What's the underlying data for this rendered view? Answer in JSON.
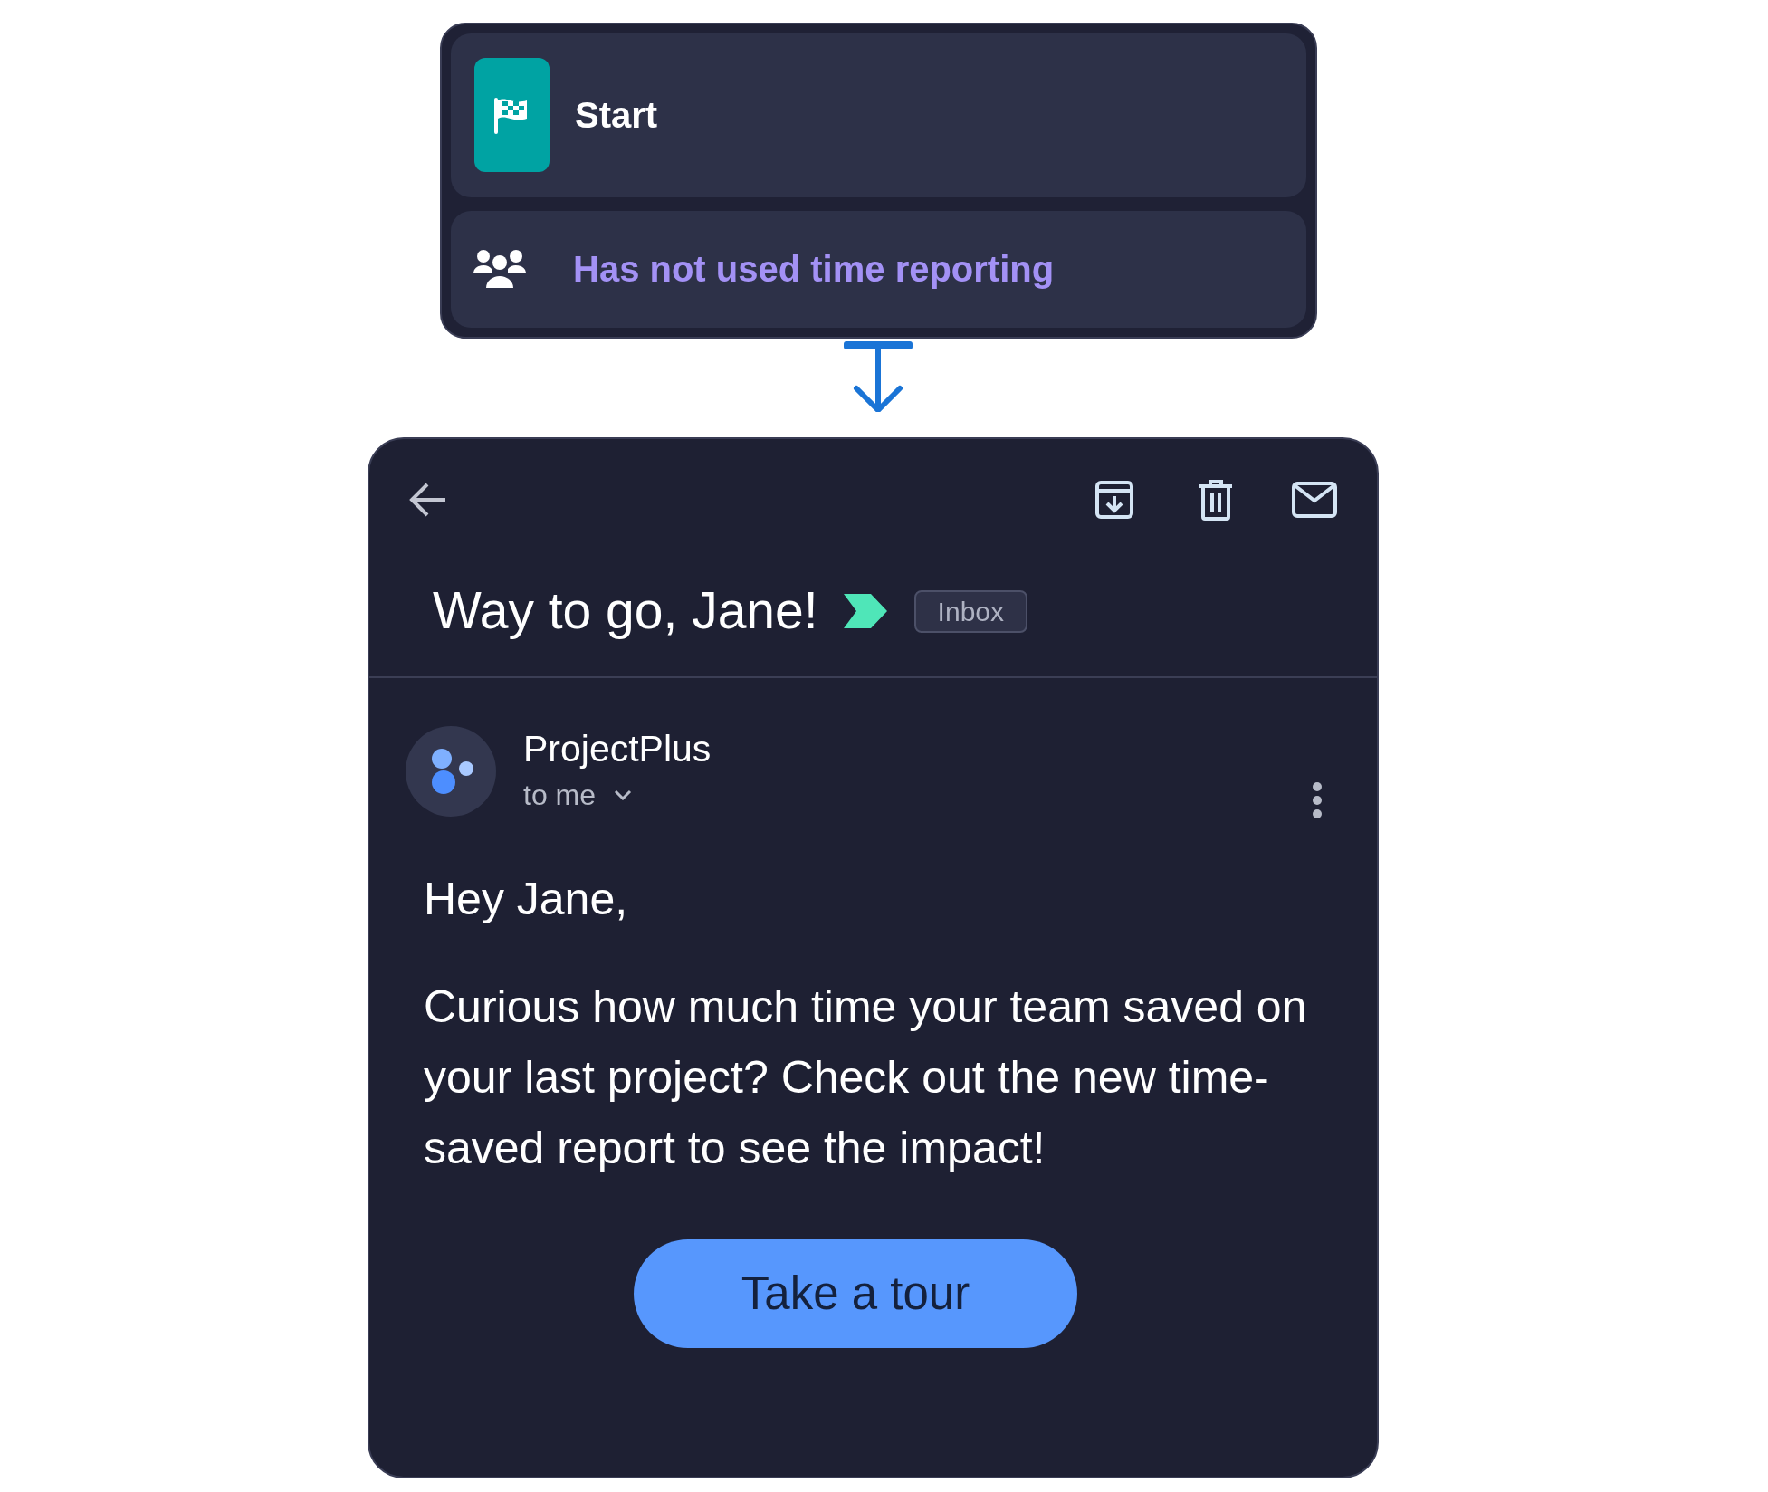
{
  "flow_step": {
    "trigger": {
      "label": "Start"
    },
    "condition": {
      "label": "Has not used time reporting"
    }
  },
  "email": {
    "subject": "Way to go, Jane!",
    "label_tag": "Inbox",
    "sender": "ProjectPlus",
    "recipient": "to me",
    "greeting": "Hey Jane,",
    "body": "Curious how much time your team saved on your last project? Check out the new time-saved report to see the impact!",
    "button": "Take a tour"
  }
}
